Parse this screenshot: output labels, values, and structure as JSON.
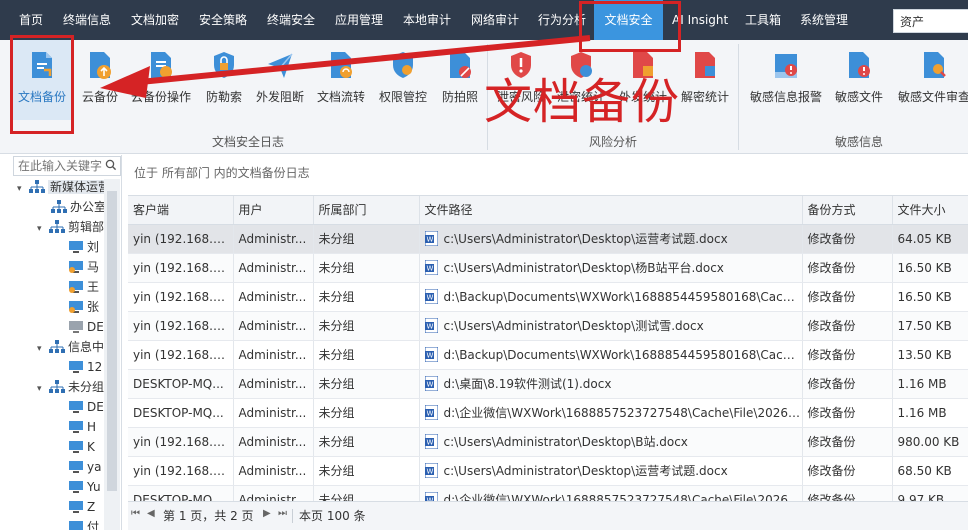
{
  "menu": [
    {
      "label": "首页"
    },
    {
      "label": "终端信息"
    },
    {
      "label": "文档加密"
    },
    {
      "label": "安全策略"
    },
    {
      "label": "终端安全"
    },
    {
      "label": "应用管理"
    },
    {
      "label": "本地审计"
    },
    {
      "label": "网络审计"
    },
    {
      "label": "行为分析"
    },
    {
      "label": "文档安全"
    },
    {
      "label": "AI Insight"
    },
    {
      "label": "工具箱"
    },
    {
      "label": "系统管理"
    }
  ],
  "search": {
    "value": "资产"
  },
  "ribbon": {
    "groups": [
      {
        "label": "文档安全日志"
      },
      {
        "label": "风险分析"
      },
      {
        "label": "敏感信息"
      }
    ],
    "buttons": [
      {
        "label": "文档备份",
        "icon": "doc-backup-icon"
      },
      {
        "label": "云备份",
        "icon": "cloud-backup-icon"
      },
      {
        "label": "云备份操作",
        "icon": "cloud-backup-operation-icon"
      },
      {
        "label": "防勒索",
        "icon": "anti-ransomware-icon"
      },
      {
        "label": "外发阻断",
        "icon": "outgoing-block-icon"
      },
      {
        "label": "文档流转",
        "icon": "doc-flow-icon"
      },
      {
        "label": "权限管控",
        "icon": "permission-control-icon"
      },
      {
        "label": "防拍照",
        "icon": "anti-photo-icon"
      },
      {
        "label": "泄密风险",
        "icon": "leak-risk-icon"
      },
      {
        "label": "泄密统计",
        "icon": "leak-stats-icon"
      },
      {
        "label": "外发统计",
        "icon": "outgoing-stats-icon"
      },
      {
        "label": "解密统计",
        "icon": "decrypt-stats-icon"
      },
      {
        "label": "敏感信息报警",
        "icon": "sensitive-alert-icon"
      },
      {
        "label": "敏感文件",
        "icon": "sensitive-file-icon"
      },
      {
        "label": "敏感文件审查",
        "icon": "sensitive-file-review-icon"
      }
    ]
  },
  "tree": {
    "search_placeholder": "在此输入关键字",
    "nodes": [
      {
        "label": "新媒体运营"
      },
      {
        "label": "办公室"
      },
      {
        "label": "剪辑部"
      },
      {
        "label": "刘"
      },
      {
        "label": "马"
      },
      {
        "label": "王"
      },
      {
        "label": "张"
      },
      {
        "label": "DE"
      },
      {
        "label": "信息中心"
      },
      {
        "label": "12"
      },
      {
        "label": "未分组"
      },
      {
        "label": "DE"
      },
      {
        "label": "H"
      },
      {
        "label": "K"
      },
      {
        "label": "ya"
      },
      {
        "label": "Yu"
      },
      {
        "label": "Z"
      },
      {
        "label": "付"
      }
    ]
  },
  "breadcrumb": "位于 所有部门 内的文档备份日志",
  "table": {
    "columns": [
      "客户端",
      "用户",
      "所属部门",
      "文件路径",
      "备份方式",
      "文件大小"
    ],
    "rows": [
      [
        "yin (192.168.3....",
        "Administr...",
        "未分组",
        "c:\\Users\\Administrator\\Desktop\\运营考试题.docx",
        "修改备份",
        "64.05 KB"
      ],
      [
        "yin (192.168.3....",
        "Administr...",
        "未分组",
        "c:\\Users\\Administrator\\Desktop\\杨B站平台.docx",
        "修改备份",
        "16.50 KB"
      ],
      [
        "yin (192.168.3....",
        "Administr...",
        "未分组",
        "d:\\Backup\\Documents\\WXWork\\1688854459580168\\Cach...",
        "修改备份",
        "16.50 KB"
      ],
      [
        "yin (192.168.3....",
        "Administr...",
        "未分组",
        "c:\\Users\\Administrator\\Desktop\\测试雪.docx",
        "修改备份",
        "17.50 KB"
      ],
      [
        "yin (192.168.3....",
        "Administr...",
        "未分组",
        "d:\\Backup\\Documents\\WXWork\\1688854459580168\\Cach...",
        "修改备份",
        "13.50 KB"
      ],
      [
        "DESKTOP-MQ...",
        "Administr...",
        "未分组",
        "d:\\桌面\\8.19软件测试(1).docx",
        "修改备份",
        "1.16 MB"
      ],
      [
        "DESKTOP-MQ...",
        "Administr...",
        "未分组",
        "d:\\企业微信\\WXWork\\1688857523727548\\Cache\\File\\2026-...",
        "修改备份",
        "1.16 MB"
      ],
      [
        "yin (192.168.3....",
        "Administr...",
        "未分组",
        "c:\\Users\\Administrator\\Desktop\\B站.docx",
        "修改备份",
        "980.00 KB"
      ],
      [
        "yin (192.168.3....",
        "Administr...",
        "未分组",
        "c:\\Users\\Administrator\\Desktop\\运营考试题.docx",
        "修改备份",
        "68.50 KB"
      ],
      [
        "DESKTOP-MQ...",
        "Administr...",
        "未分组",
        "d:\\企业微信\\WXWork\\1688857523727548\\Cache\\File\\2026-...",
        "修改备份",
        "9.97 KB"
      ]
    ]
  },
  "pager": {
    "page_text": "第 1 页，共 2 页",
    "count_text": "本页 100 条"
  },
  "annotation": {
    "text": "文档备份",
    "color": "#d52325"
  },
  "colors": {
    "menu_bg": "#2f3b4c",
    "active_tab": "#3b95df",
    "accent_blue": "#3d8fd8",
    "warning_red": "#e04848",
    "annotation_red": "#d52325"
  }
}
